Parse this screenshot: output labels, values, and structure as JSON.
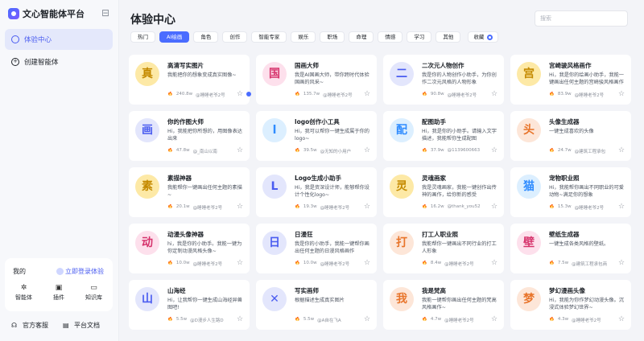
{
  "app": {
    "brand": "文心智能体平台"
  },
  "sidebar": {
    "items": [
      {
        "label": "体验中心",
        "active": true
      },
      {
        "label": "创建智能体",
        "active": false
      }
    ],
    "mine": {
      "title": "我的",
      "login": "立即登录体验",
      "tools": [
        {
          "label": "智能体",
          "icon": "sparkle-icon"
        },
        {
          "label": "插件",
          "icon": "plugin-icon"
        },
        {
          "label": "知识库",
          "icon": "knowledge-icon"
        }
      ]
    },
    "footer": [
      {
        "label": "官方客服",
        "icon": "headset-icon"
      },
      {
        "label": "平台文档",
        "icon": "document-icon"
      }
    ]
  },
  "main": {
    "title": "体验中心",
    "search_placeholder": "搜索",
    "filters": [
      "热门",
      "AI绘画",
      "角色",
      "创作",
      "智能专家",
      "娱乐",
      "职场",
      "命理",
      "情感",
      "学习",
      "其他"
    ],
    "active_filter": 1,
    "collect_label": "收藏",
    "cards": [
      {
        "avatar": "真",
        "bg": "#fde9a6",
        "fg": "#c48a00",
        "name": "高清写实图片",
        "desc": "我能把你的想象变成真实图像~",
        "views": "240.8w",
        "author": "@睡睡老爷2号",
        "dot": true
      },
      {
        "avatar": "国",
        "bg": "#fde0ec",
        "fg": "#d6336c",
        "name": "国画大师",
        "desc": "我是AI国画大师，带你跨时代体验国画的风采~",
        "views": "135.7w",
        "author": "@睡睡老爷2号"
      },
      {
        "avatar": "二",
        "bg": "#e3e6fc",
        "fg": "#4a5cf0",
        "name": "二次元人物创作",
        "desc": "我是你的人物创作小助手，为你创作二次元风格的人物形象",
        "views": "90.8w",
        "author": "@睡睡老爷2号"
      },
      {
        "avatar": "宫",
        "bg": "#fde9a6",
        "fg": "#c48a00",
        "name": "宫崎骏风格画作",
        "desc": "Hi，我是你的绘画小助手，我能一键画出任何主题的宫崎骏风格画作",
        "views": "83.9w",
        "author": "@睡睡老爷2号"
      },
      {
        "avatar": "画",
        "bg": "#e3e6fc",
        "fg": "#4a5cf0",
        "name": "你的作图大师",
        "desc": "Hi，我能把你所想的，用图像表达出来",
        "views": "47.8w",
        "author": "@_南山以南"
      },
      {
        "avatar": "l",
        "bg": "#dcefff",
        "fg": "#2f8cff",
        "name": "logo创作小工具",
        "desc": "Hi，我可以帮你一键生成属于你的logo~",
        "views": "39.5w",
        "author": "@无知的小用户"
      },
      {
        "avatar": "配",
        "bg": "#dcefff",
        "fg": "#2f8cff",
        "name": "配图助手",
        "desc": "Hi，我是你的小助手。请输入文字描述，我能帮你生成配图",
        "views": "37.9w",
        "author": "@1139600663"
      },
      {
        "avatar": "头",
        "bg": "#fde6d8",
        "fg": "#e8742a",
        "name": "头像生成器",
        "desc": "一键生成喜欢的头像",
        "views": "24.7w",
        "author": "@建筑工程承包"
      },
      {
        "avatar": "素",
        "bg": "#fde9a6",
        "fg": "#c48a00",
        "name": "素描神器",
        "desc": "我能帮你一键画出任何主题的素描~",
        "views": "20.1w",
        "author": "@睡睡老爷2号"
      },
      {
        "avatar": "L",
        "bg": "#e3e6fc",
        "fg": "#4a5cf0",
        "name": "Logo生成小助手",
        "desc": "Hi，我是资深设计师，能够帮你设计个性化logo~",
        "views": "19.3w",
        "author": "@睡睡老爷2号"
      },
      {
        "avatar": "灵",
        "bg": "#fde9a6",
        "fg": "#c48a00",
        "name": "灵魂画家",
        "desc": "我是灵魂画家，我能一键创作出传神的画作，给你新的感受",
        "views": "16.2w",
        "author": "@thank_you52"
      },
      {
        "avatar": "猫",
        "bg": "#dcefff",
        "fg": "#2f8cff",
        "name": "宠物职业照",
        "desc": "Hi，我能帮你画出不同职业的可爱动物~满足你的想象",
        "views": "15.3w",
        "author": "@睡睡老爷2号"
      },
      {
        "avatar": "动",
        "bg": "#fde0ec",
        "fg": "#d6336c",
        "name": "动漫头像神器",
        "desc": "hi，我是你的小助手。我能一键为你定制动漫风格头像~",
        "views": "10.0w",
        "author": "@睡睡老爷2号"
      },
      {
        "avatar": "日",
        "bg": "#e3e6fc",
        "fg": "#4a5cf0",
        "name": "日漫狂",
        "desc": "我是你的小助手，我能一键帮你画出任何主题的日漫风格画作",
        "views": "10.0w",
        "author": "@睡睡老爷2号"
      },
      {
        "avatar": "打",
        "bg": "#fde6d8",
        "fg": "#e8742a",
        "name": "打工人职业照",
        "desc": "我能帮你一键画出不同行业的打工人形象",
        "views": "8.4w",
        "author": "@睡睡老爷2号"
      },
      {
        "avatar": "壁",
        "bg": "#fde0ec",
        "fg": "#d6336c",
        "name": "壁纸生成器",
        "desc": "一键生成各类风格的壁纸。",
        "views": "7.5w",
        "author": "@建筑工程承包商"
      },
      {
        "avatar": "山",
        "bg": "#e3e6fc",
        "fg": "#4a5cf0",
        "name": "山海经",
        "desc": "Hi，让我帮你一键生成山海经异兽图吧!",
        "views": "5.5w",
        "author": "@D漫步人生路D"
      },
      {
        "avatar": "✕",
        "bg": "#e3e6fc",
        "fg": "#4a5cf0",
        "name": "写实画师",
        "desc": "根据描述生成真实图片",
        "views": "5.5w",
        "author": "@A自在飞A"
      },
      {
        "avatar": "我",
        "bg": "#fde6d8",
        "fg": "#e8742a",
        "name": "我是梵高",
        "desc": "我能一键帮你画出任何主题的梵高风格画作~",
        "views": "4.7w",
        "author": "@睡睡老爷2号"
      },
      {
        "avatar": "梦",
        "bg": "#fde6d8",
        "fg": "#e8742a",
        "name": "梦幻漫画头像",
        "desc": "Hi，我能为你作梦幻动漫头像。沉浸式体验梦幻世界~",
        "views": "4.3w",
        "author": "@睡睡老爷2号"
      }
    ]
  }
}
